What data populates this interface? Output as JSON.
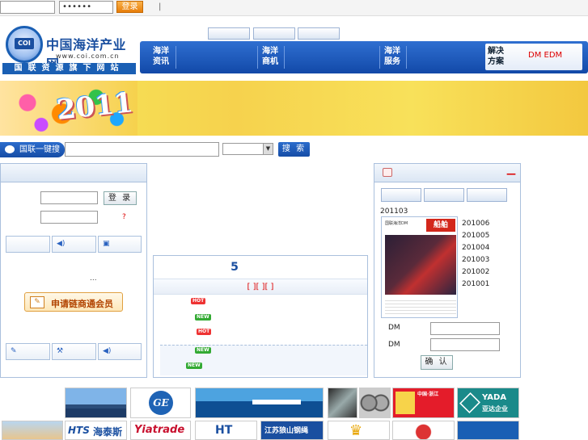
{
  "topbar": {
    "username_value": "",
    "password_value": "••••••",
    "login_label": "登录",
    "separator": "|"
  },
  "header": {
    "logo_abbr": "COI",
    "site_name": "中国海洋产业网",
    "site_url": "www.coi.com.cn",
    "slogan": "国联资源旗下网站"
  },
  "nav": {
    "items": [
      {
        "line1": "海洋",
        "line2": "资讯"
      },
      {
        "line1": "海洋",
        "line2": "商机"
      },
      {
        "line1": "海洋",
        "line2": "服务"
      }
    ],
    "solution_line1": "解决",
    "solution_line2": "方案",
    "dm_edm": "DM EDM"
  },
  "banner": {
    "year": "2011"
  },
  "search": {
    "label": "国联一键搜",
    "query": "",
    "button": "搜 索"
  },
  "left_panel": {
    "login_button": "登 录",
    "question_mark": "?",
    "dots": "...",
    "apply_button": "申请链商通会员"
  },
  "middle_panel": {
    "number": "5",
    "links": "[ ][ ][ ]",
    "badges": [
      "HOT",
      "NEW",
      "HOT",
      "NEW",
      "NEW"
    ]
  },
  "right_panel": {
    "minus": "—",
    "current_issue": "201103",
    "cover_title": "国联海洋DM",
    "cover_red": "船舶",
    "issues": [
      "201006",
      "201005",
      "201004",
      "201003",
      "201002",
      "201001"
    ],
    "dm_label_1": "DM",
    "dm_label_2": "DM",
    "confirm_button": "确 认"
  },
  "ads": {
    "row1": [
      "GE",
      "中国·浙江",
      "YADA",
      "亚达企业"
    ],
    "row2": [
      "HTS",
      "海泰斯",
      "Yiatrade",
      "江苏狼山钢绳",
      "HT"
    ]
  },
  "colors": {
    "brand_blue": "#1a4fa0",
    "nav_blue": "#1249a8",
    "accent_orange": "#e77d0a",
    "red": "#d3271b"
  }
}
